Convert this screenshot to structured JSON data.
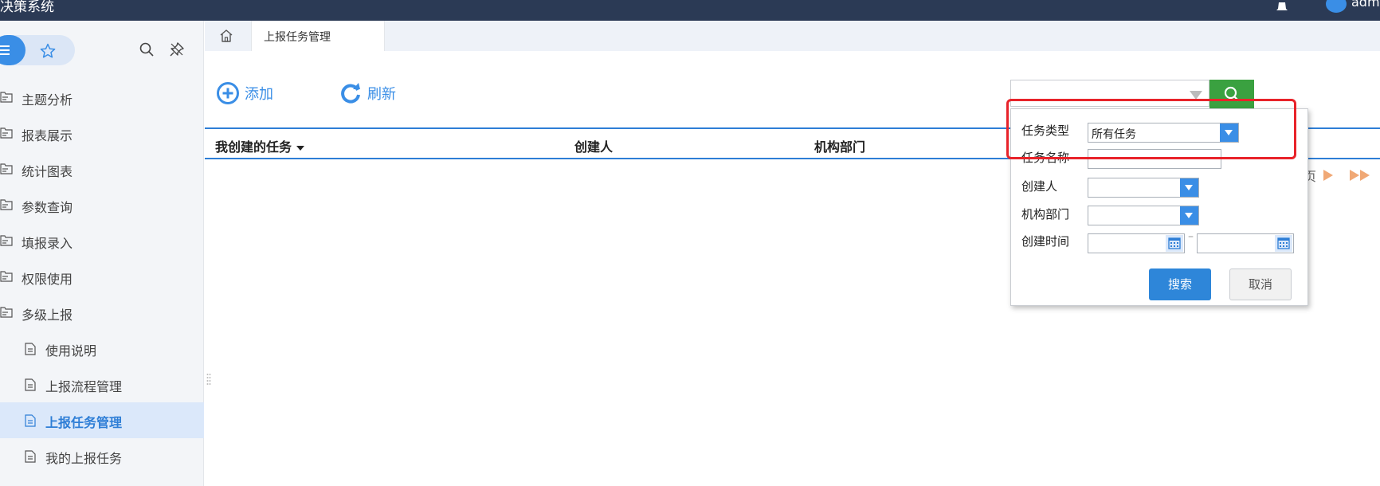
{
  "app": {
    "title": "决策系统",
    "user": "admin"
  },
  "sidebar": {
    "items": [
      {
        "label": "主题分析"
      },
      {
        "label": "报表展示"
      },
      {
        "label": "统计图表"
      },
      {
        "label": "参数查询"
      },
      {
        "label": "填报录入"
      },
      {
        "label": "权限使用"
      },
      {
        "label": "多级上报"
      }
    ],
    "sub_items": [
      {
        "label": "使用说明"
      },
      {
        "label": "上报流程管理"
      },
      {
        "label": "上报任务管理"
      },
      {
        "label": "我的上报任务"
      }
    ]
  },
  "tabs": {
    "active": "上报任务管理"
  },
  "toolbar": {
    "add_label": "添加",
    "refresh_label": "刷新"
  },
  "table": {
    "columns": [
      "我创建的任务",
      "创建人",
      "机构部门"
    ]
  },
  "pager": {
    "text": "页"
  },
  "search_panel": {
    "task_type_label": "任务类型",
    "task_type_value": "所有任务",
    "task_name_label": "任务名称",
    "creator_label": "创建人",
    "department_label": "机构部门",
    "create_time_label": "创建时间",
    "date_separator": "–",
    "search_button": "搜索",
    "cancel_button": "取消"
  },
  "colors": {
    "primary": "#2e86d9",
    "search_green": "#3aa140",
    "header_bg": "#2b3a55",
    "highlight": "#e8232a"
  },
  "icons": [
    "menu-icon",
    "star-icon",
    "search-icon",
    "pin-icon",
    "folder-icon",
    "document-icon",
    "home-icon",
    "add-icon",
    "refresh-icon",
    "calendar-icon",
    "bell-icon",
    "user-icon"
  ]
}
